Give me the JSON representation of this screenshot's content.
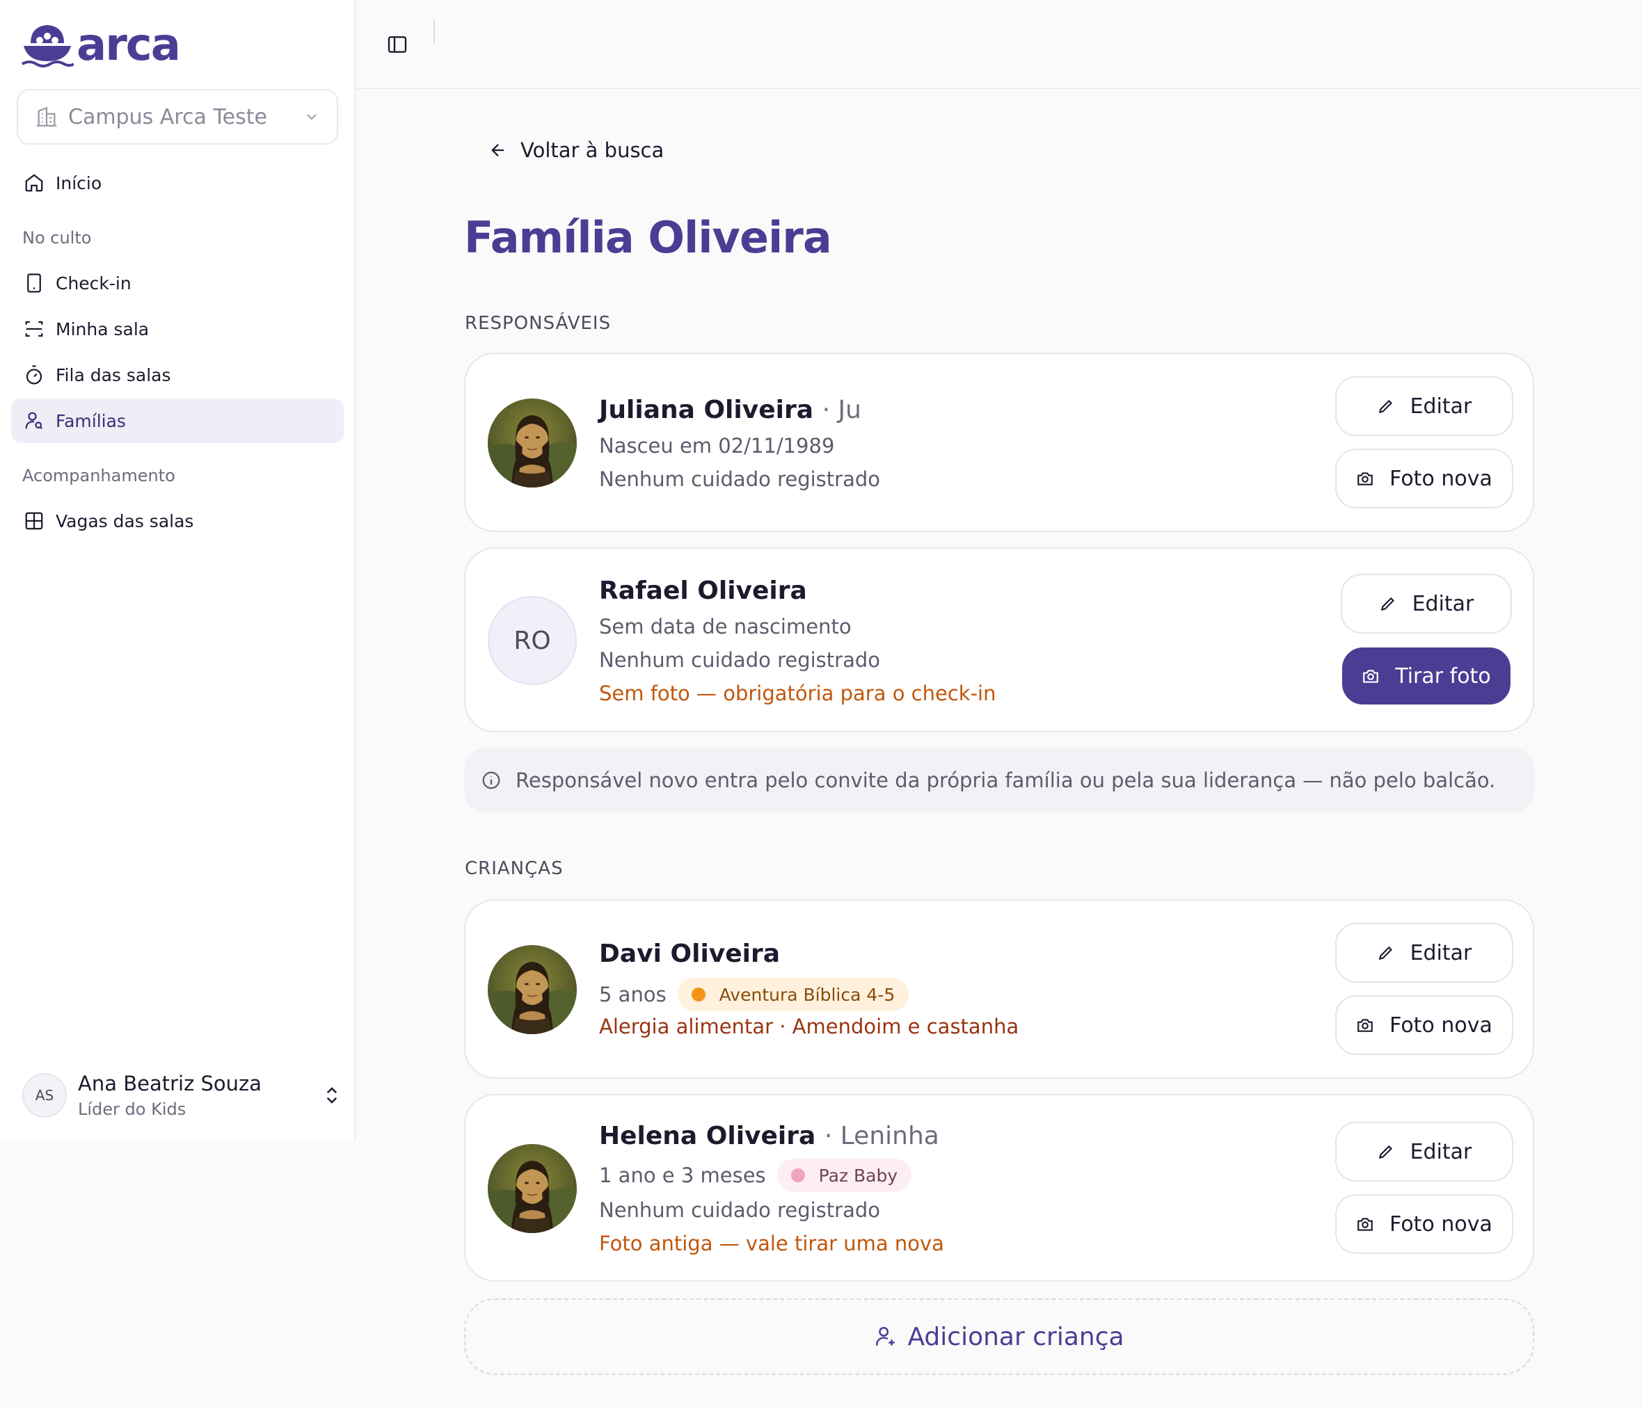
{
  "app": {
    "logo_text": "arca",
    "brand_color": "#4c3d94"
  },
  "sidebar": {
    "campus": {
      "label": "Campus Arca Teste",
      "icon": "building-icon"
    },
    "home": {
      "label": "Início",
      "icon": "home-icon"
    },
    "section_culto": "No culto",
    "items_culto": [
      {
        "label": "Check-in",
        "icon": "tablet-icon"
      },
      {
        "label": "Minha sala",
        "icon": "scan-icon"
      },
      {
        "label": "Fila das salas",
        "icon": "timer-icon"
      },
      {
        "label": "Famílias",
        "icon": "user-search-icon",
        "active": true
      }
    ],
    "section_acomp": "Acompanhamento",
    "items_acomp": [
      {
        "label": "Vagas das salas",
        "icon": "grid-icon"
      }
    ],
    "user": {
      "initials": "AS",
      "name": "Ana Beatriz Souza",
      "role": "Líder do Kids"
    }
  },
  "main": {
    "back_label": "Voltar à busca",
    "title": "Família Oliveira",
    "responsaveis_title": "RESPONSÁVEIS",
    "responsaveis": [
      {
        "name": "Juliana Oliveira",
        "nickname": "· Ju",
        "birth": "Nasceu em 02/11/1989",
        "care": "Nenhum cuidado registrado",
        "edit_label": "Editar",
        "photo_label": "Foto nova"
      },
      {
        "initials": "RO",
        "name": "Rafael Oliveira",
        "birth": "Sem data de nascimento",
        "care": "Nenhum cuidado registrado",
        "warning": "Sem foto — obrigatória para o check-in",
        "edit_label": "Editar",
        "photo_label": "Tirar foto"
      }
    ],
    "info_note": "Responsável novo entra pelo convite da própria família ou pela sua liderança — não pelo balcão.",
    "criancas_title": "CRIANÇAS",
    "criancas": [
      {
        "name": "Davi Oliveira",
        "age": "5 anos",
        "room": "Aventura Bíblica 4-5",
        "room_color": "#f59316",
        "allergy": "Alergia alimentar · Amendoim e castanha",
        "edit_label": "Editar",
        "photo_label": "Foto nova"
      },
      {
        "name": "Helena Oliveira",
        "nickname": "· Leninha",
        "age": "1 ano e 3 meses",
        "room": "Paz Baby",
        "room_color": "#f2a3c1",
        "care": "Nenhum cuidado registrado",
        "warning": "Foto antiga — vale tirar uma nova",
        "edit_label": "Editar",
        "photo_label": "Foto nova"
      }
    ],
    "add_child_label": "Adicionar criança"
  }
}
